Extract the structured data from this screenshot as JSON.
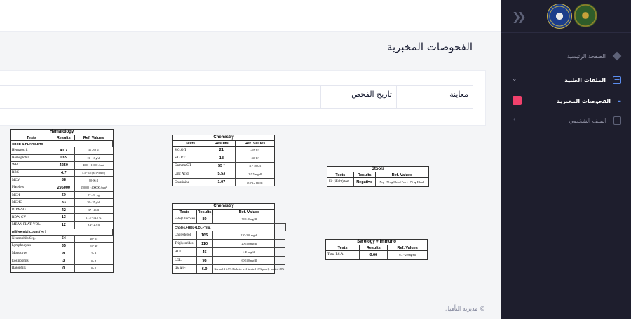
{
  "sidebar": {
    "collapse_icon": "double-chevron-icon",
    "items": [
      {
        "label": "الصفحة الرئيسية",
        "icon": "home-diamond-icon"
      },
      {
        "label": "الملفات الطبية",
        "icon": "heartbeat-icon"
      },
      {
        "label": "الفحوصات المخبرية",
        "icon": "dash-icon"
      },
      {
        "label": "الملف الشخصي",
        "icon": "profile-card-icon"
      }
    ],
    "accent_color": "#f1416c"
  },
  "page": {
    "title": "الفحوصات المخبرية",
    "columns": [
      "معاينة",
      "تاريخ الفحص"
    ],
    "footer": "© مديرية التأهيل"
  },
  "hematology": {
    "title": "Hematology",
    "headers": [
      "Tests",
      "Results",
      "Ref. Values"
    ],
    "section1": "CBCD & PLATELETS",
    "rows": [
      [
        "Hematocrit",
        "41.7",
        "40 - 54 %"
      ],
      [
        "Hemoglobin",
        "13.9",
        "13 - 18 g/dl"
      ],
      [
        "WBC",
        "4250",
        "4000 - 11000 /mm³"
      ],
      [
        "RBC",
        "4.7",
        "4.5 - 6.5 [x10⁶/mm³]"
      ],
      [
        "MCV",
        "88",
        "80-96 fl"
      ],
      [
        "Platelets",
        "296000",
        "150000 - 400000 /mm³"
      ],
      [
        "MCH",
        "29",
        "27 - 31 pg"
      ],
      [
        "MCHC",
        "33",
        "30 - 35 g/dl"
      ],
      [
        "RDW-SD",
        "42",
        "37 - 46 fl"
      ],
      [
        "RDW-CV",
        "13",
        "11.5 - 14.5 %"
      ],
      [
        "MEAN PLAT. VOL.",
        "12",
        "9.4-12.3 fl"
      ]
    ],
    "section2": "Differential Count ( % )",
    "rows2": [
      [
        "Neutrophils Seg.",
        "54",
        "40 - 65"
      ],
      [
        "Lymphocytes",
        "35",
        "25 - 40"
      ],
      [
        "Monocytes",
        "8",
        "2 - 8"
      ],
      [
        "Eosinophils",
        "3",
        "0 - 4"
      ],
      [
        "Basophils",
        "0",
        "0 - 1"
      ]
    ]
  },
  "chemistry1": {
    "title": "Chemistry",
    "headers": [
      "Tests",
      "Results",
      "Ref. Values"
    ],
    "rows": [
      [
        "S.G.O.T",
        "21",
        "<45 U/l"
      ],
      [
        "S.G.P.T",
        "18",
        "<40 U/l"
      ],
      [
        "Gamma GT",
        "55 *",
        "11 - 50 U/l"
      ],
      [
        "Uric Acid",
        "5.53",
        "2-7.5 mg/dl"
      ],
      [
        "Creatinine",
        "1.07",
        "0.6-1.2 mg/dl"
      ]
    ]
  },
  "chemistry2": {
    "title": "Chemistry",
    "headers": [
      "Tests",
      "Results",
      "Ref. Values"
    ],
    "rows_a": [
      [
        "FBS(Glucose)",
        "80",
        "70-110 mg/dl"
      ]
    ],
    "section": "Choles.+HDL+LDL+Trig.",
    "rows_b": [
      [
        "Cholesterol",
        "165",
        "120-200 mg/dl"
      ],
      [
        "Triglycerides",
        "110",
        "20-160 mg/dl"
      ],
      [
        "HDL",
        "45",
        ">45 mg/dl"
      ],
      [
        "LDL",
        "98",
        "60-130 mg/dl"
      ],
      [
        "Hb A1c",
        "6.0",
        "Normal 4-6.5% Diabetic well treated <7% poorly treated >8%"
      ]
    ]
  },
  "stools": {
    "title": "Stools",
    "headers": [
      "Tests",
      "Results",
      "Ref. Values"
    ],
    "rows": [
      [
        "Fit (iFobt) test",
        "Negative",
        "Neg <75 ng Hb/ml Pos. >=75 ng Hb/ml"
      ]
    ]
  },
  "serology": {
    "title": "Serology + Immuno",
    "headers": [
      "Tests",
      "Results",
      "Ref. Values"
    ],
    "rows": [
      [
        "Total P.S.A",
        "0.66",
        "0.2 - 2.9 ng/ml"
      ]
    ]
  }
}
